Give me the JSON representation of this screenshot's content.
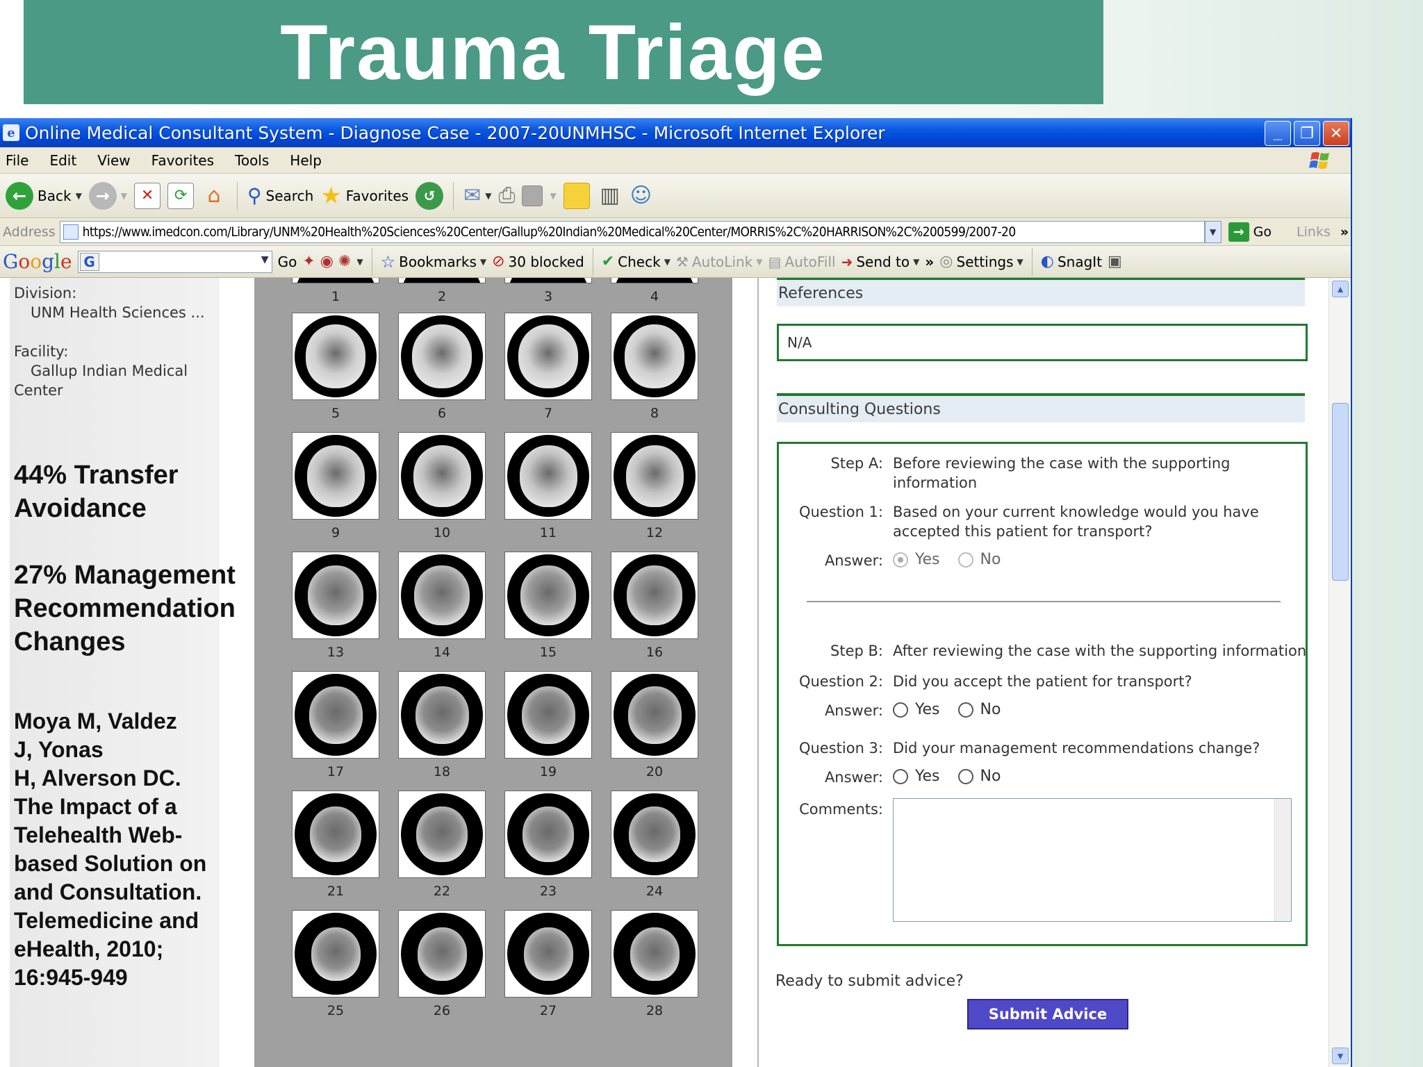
{
  "slide": {
    "title": "Trauma Triage"
  },
  "window": {
    "title": "Online Medical Consultant System - Diagnose Case - 2007-20UNMHSC - Microsoft Internet Explorer"
  },
  "menu": [
    "File",
    "Edit",
    "View",
    "Favorites",
    "Tools",
    "Help"
  ],
  "toolbar": {
    "back": "Back",
    "search": "Search",
    "favorites": "Favorites"
  },
  "address": {
    "label": "Address",
    "url": "https://www.imedcon.com/Library/UNM%20Health%20Sciences%20Center/Gallup%20Indian%20Medical%20Center/MORRIS%2C%20HARRISON%2C%200599/2007-20",
    "go": "Go",
    "links": "Links"
  },
  "googlebar": {
    "go": "Go",
    "bookmarks": "Bookmarks",
    "blocked": "30 blocked",
    "check": "Check",
    "autolink": "AutoLink",
    "autofill": "AutoFill",
    "send_to": "Send to",
    "settings": "Settings",
    "snagit": "SnagIt"
  },
  "case_info": {
    "division_label": "Division:",
    "division_value": "UNM Health Sciences ...",
    "facility_label": "Facility:",
    "facility_value_line1": "Gallup Indian Medical",
    "facility_value_line2": "Center"
  },
  "overlay": {
    "stat1_line1": "44% Transfer",
    "stat1_line2": "Avoidance",
    "stat2_line1": "27% Management",
    "stat2_line2": "Recommendation",
    "stat2_line3": "Changes",
    "citation": [
      "Moya M, Valdez",
      "J, Yonas",
      "H, Alverson DC.",
      "The Impact of a",
      "Telehealth Web-",
      "based Solution on",
      "and Consultation.",
      "Telemedicine and",
      "eHealth, 2010;",
      "16:945-949"
    ]
  },
  "scans": {
    "top_row_numbers": [
      "1",
      "2",
      "3",
      "4"
    ],
    "numbers": [
      "5",
      "6",
      "7",
      "8",
      "9",
      "10",
      "11",
      "12",
      "13",
      "14",
      "15",
      "16",
      "17",
      "18",
      "19",
      "20",
      "21",
      "22",
      "23",
      "24",
      "25",
      "26",
      "27",
      "28"
    ]
  },
  "references": {
    "heading": "References",
    "value": "N/A"
  },
  "consulting": {
    "heading": "Consulting Questions",
    "step_a_label": "Step A:",
    "step_a_text": "Before reviewing the case with the supporting information",
    "q1_label": "Question 1:",
    "q1_text": "Based on your current knowledge would you have accepted this patient for transport?",
    "answer_label": "Answer:",
    "yes": "Yes",
    "no": "No",
    "step_b_label": "Step B:",
    "step_b_text": "After reviewing the case with the supporting information",
    "q2_label": "Question 2:",
    "q2_text": "Did you accept the patient for transport?",
    "q3_label": "Question 3:",
    "q3_text": "Did your management recommendations change?",
    "comments_label": "Comments:"
  },
  "submit": {
    "prompt": "Ready to submit advice?",
    "button": "Submit Advice"
  },
  "colors": {
    "title_band": "#4a9a86",
    "accent_green": "#1f7a2f",
    "submit": "#4f49c8",
    "xp_blue": "#0a58e0"
  }
}
